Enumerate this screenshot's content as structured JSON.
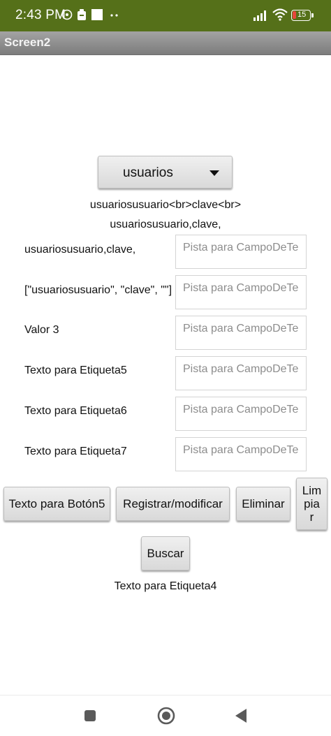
{
  "status": {
    "time": "2:43 PM",
    "battery": "15"
  },
  "title": "Screen2",
  "spinner": {
    "value": "usuarios"
  },
  "labels": {
    "line1": "usuariosusuario<br>clave<br>",
    "line2": "usuariosusuario,clave,"
  },
  "rows": [
    {
      "label": "usuariosusuario,clave,",
      "placeholder": "Pista para CampoDeTe"
    },
    {
      "label": "[\"usuariosusuario\", \"clave\", \"\"]",
      "placeholder": "Pista para CampoDeTe"
    },
    {
      "label": "Valor 3",
      "placeholder": "Pista para CampoDeTe"
    },
    {
      "label": "Texto para Etiqueta5",
      "placeholder": "Pista para CampoDeTe"
    },
    {
      "label": "Texto para Etiqueta6",
      "placeholder": "Pista para CampoDeTe"
    },
    {
      "label": "Texto para Etiqueta7",
      "placeholder": "Pista para CampoDeTe"
    }
  ],
  "buttons": {
    "boton5": "Texto para Botón5",
    "registrar": "Registrar/modificar",
    "eliminar": "Eliminar",
    "limpiar_1": "Lim",
    "limpiar_2": "pia",
    "limpiar_3": "r",
    "buscar": "Buscar"
  },
  "etiqueta4": "Texto para Etiqueta4"
}
